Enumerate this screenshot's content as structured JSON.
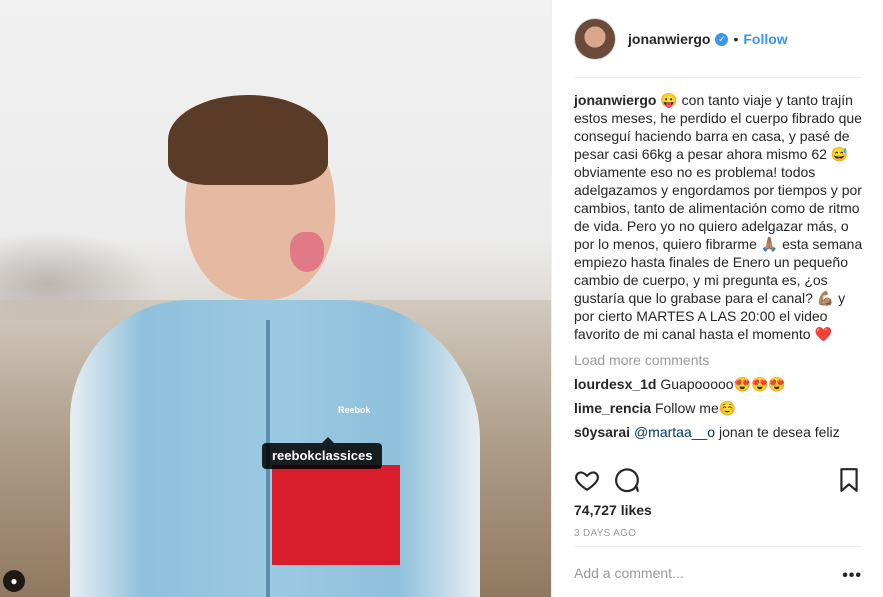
{
  "photo": {
    "tag_label": "reebokclassices",
    "brand_logo": "Reebok"
  },
  "header": {
    "username": "jonanwiergo",
    "separator": "•",
    "follow_label": "Follow"
  },
  "caption": {
    "username": "jonanwiergo",
    "text": "😛 con tanto viaje y tanto trajín estos meses, he perdido el cuerpo fibrado que conseguí haciendo barra en casa, y pasé de pesar casi 66kg a pesar ahora mismo 62 😅 obviamente eso no es problema! todos adelgazamos y engordamos por tiempos y por cambios, tanto de alimentación como de ritmo de vida. Pero yo no quiero adelgazar más, o por lo menos, quiero fibrarme 🙏🏽 esta semana empiezo hasta finales de Enero un pequeño cambio de cuerpo, y mi pregunta es, ¿os gustaría que lo grabase para el canal? 💪🏽 y por cierto MARTES A LAS 20:00 el video favorito de mi canal hasta el momento ❤️"
  },
  "load_more": "Load more comments",
  "comments": [
    {
      "username": "lourdesx_1d",
      "text": "Guapooooo😍😍😍"
    },
    {
      "username": "lime_rencia",
      "text": "Follow me☺️"
    },
    {
      "username": "s0ysarai",
      "mention": "@martaa__o",
      "text": " jonan te desea feliz"
    }
  ],
  "likes": "74,727 likes",
  "time": "3 DAYS AGO",
  "add_comment_placeholder": "Add a comment...",
  "more_options": "•••"
}
